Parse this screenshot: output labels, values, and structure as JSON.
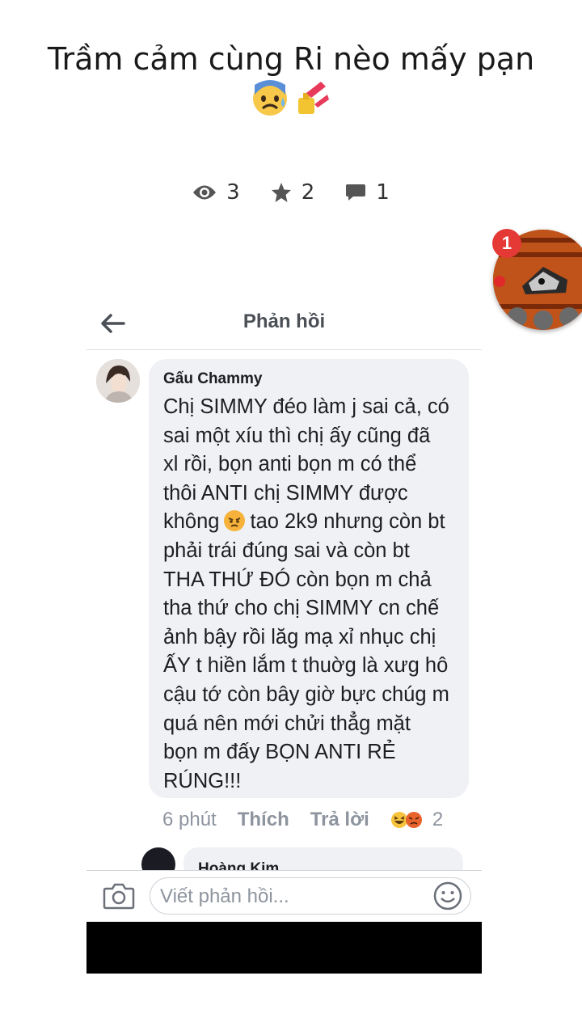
{
  "post": {
    "title": "Trầm cảm cùng Ri nèo mấy pạn",
    "emojis": [
      "anxious-sweat-face-emoji",
      "nail-polish-emoji"
    ]
  },
  "stats": {
    "views": "3",
    "stars": "2",
    "comments": "1"
  },
  "chathead": {
    "badge_count": "1"
  },
  "screenshot": {
    "header_title": "Phản hồi",
    "comment": {
      "author": "Gấu Chammy",
      "lines": [
        "Chị SIMMY đéo làm j sai cả, có",
        "sai một xíu thì chị ấy cũng đã",
        "xl rồi, bọn anti bọn m có thể",
        "thôi ANTI chị SIMMY được",
        "không",
        "tao 2k9 nhưng còn bt",
        "phải trái đúng sai và còn bt",
        "THA THỨ ĐÓ còn bọn m chả",
        "tha thứ cho chị SIMMY cn chế",
        "ảnh bậy rồi lăg mạ xỉ nhục chị",
        "ẤY t hiền lắm t thuờg là xưg hô",
        "cậu tớ còn bây giờ bực chúg m",
        "quá nên mới chửi thẳg mặt",
        "bọn m đấy BỌN ANTI RẺ",
        "RÚNG!!!"
      ],
      "time": "6 phút",
      "like_label": "Thích",
      "reply_label": "Trả lời",
      "reaction_count": "2"
    },
    "next_comment_author": "Hoàng Kim",
    "composer_placeholder": "Viết phản hồi..."
  }
}
